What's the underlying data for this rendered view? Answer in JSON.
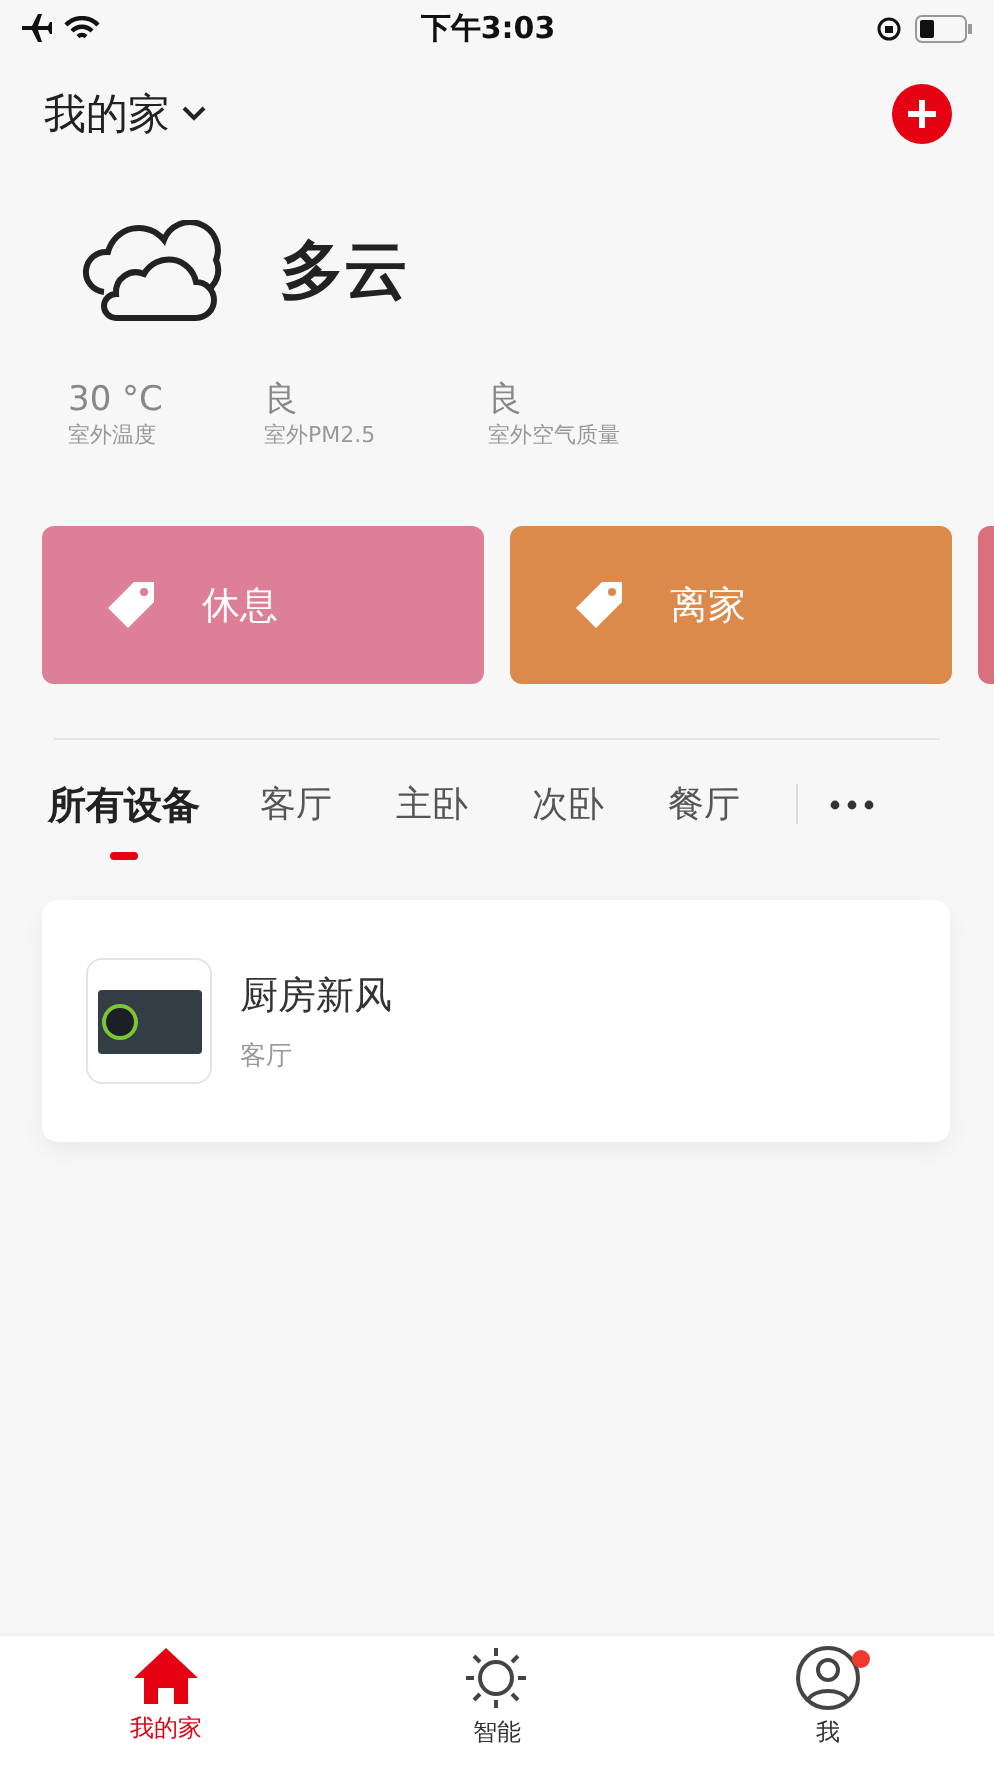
{
  "status_bar": {
    "time": "下午3:03"
  },
  "header": {
    "title": "我的家"
  },
  "weather": {
    "condition": "多云",
    "stats": [
      {
        "value": "30 °C",
        "label": "室外温度"
      },
      {
        "value": "良",
        "label": "室外PM2.5"
      },
      {
        "value": "良",
        "label": "室外空气质量"
      }
    ]
  },
  "scenes": [
    {
      "label": "休息",
      "color": "#de7f98"
    },
    {
      "label": "离家",
      "color": "#dc8a4c"
    },
    {
      "color": "#d9707d"
    }
  ],
  "room_tabs": [
    {
      "label": "所有设备",
      "selected": true
    },
    {
      "label": "客厅",
      "selected": false
    },
    {
      "label": "主卧",
      "selected": false
    },
    {
      "label": "次卧",
      "selected": false
    },
    {
      "label": "餐厅",
      "selected": false
    }
  ],
  "devices": [
    {
      "name": "厨房新风",
      "room": "客厅"
    }
  ],
  "bottom_nav": [
    {
      "kind": "home",
      "label": "我的家",
      "selected": true,
      "notification": false
    },
    {
      "kind": "smart",
      "label": "智能",
      "selected": false,
      "notification": false
    },
    {
      "kind": "me",
      "label": "我",
      "selected": false,
      "notification": true
    }
  ]
}
